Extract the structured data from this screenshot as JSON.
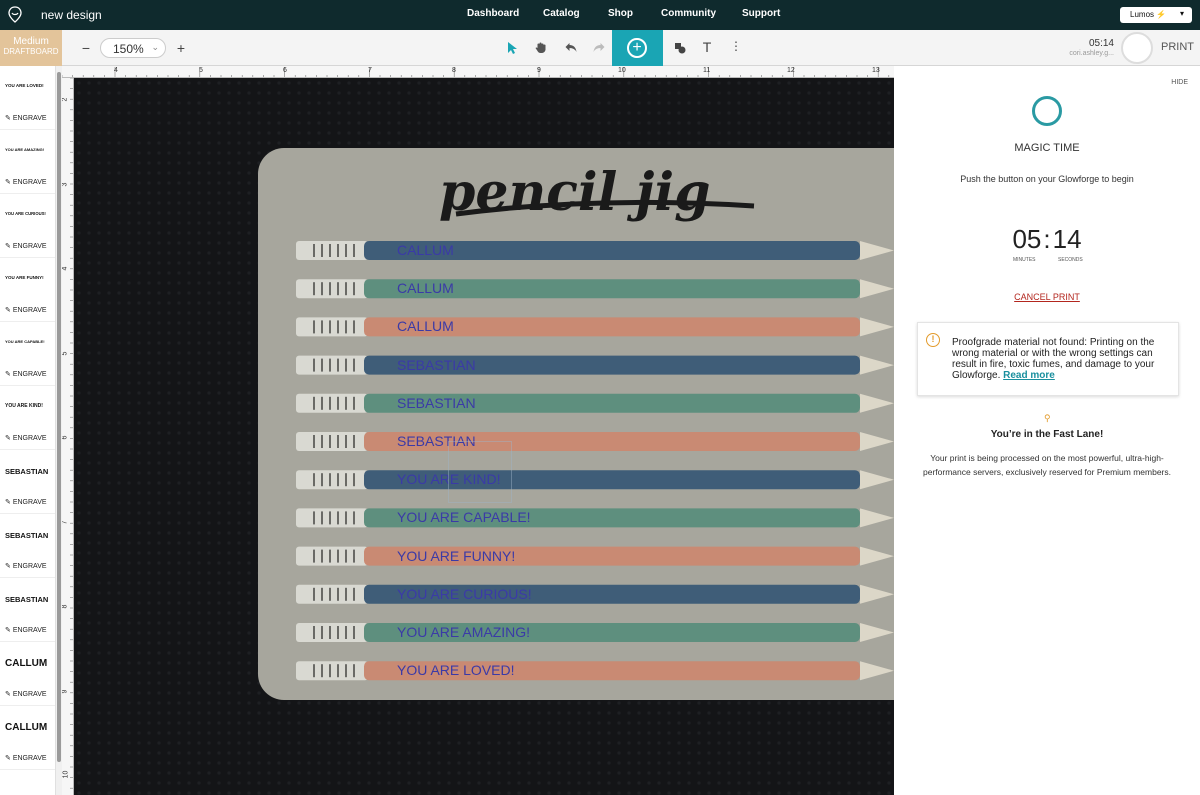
{
  "app": {
    "design_title": "new design",
    "nav": [
      "Dashboard",
      "Catalog",
      "Shop",
      "Community",
      "Support"
    ],
    "machine_name": "Lumos",
    "machine_icon": "lightning-icon"
  },
  "toolbar": {
    "material_name": "Medium",
    "material_type": "DRAFTBOARD",
    "zoom": "150%",
    "timer": "05:14",
    "user_email": "cori.ashley.g...",
    "print_label": "PRINT",
    "icons": [
      "zoom-out-icon",
      "zoom-in-icon",
      "select-arrow-icon",
      "pan-hand-icon",
      "undo-icon",
      "redo-icon",
      "add-icon",
      "shapes-icon",
      "text-icon",
      "more-icon"
    ]
  },
  "thumbnails": [
    {
      "text": "YOU ARE LOVED!",
      "action": "ENGRAVE"
    },
    {
      "text": "YOU ARE AMAZING!",
      "action": "ENGRAVE"
    },
    {
      "text": "YOU ARE CURIOUS!",
      "action": "ENGRAVE"
    },
    {
      "text": "YOU ARE FUNNY!",
      "action": "ENGRAVE"
    },
    {
      "text": "YOU ARE CAPABLE!",
      "action": "ENGRAVE"
    },
    {
      "text": "YOU ARE KIND!",
      "action": "ENGRAVE"
    },
    {
      "text": "SEBASTIAN",
      "action": "ENGRAVE"
    },
    {
      "text": "SEBASTIAN",
      "action": "ENGRAVE"
    },
    {
      "text": "SEBASTIAN",
      "action": "ENGRAVE"
    },
    {
      "text": "CALLUM",
      "action": "ENGRAVE"
    },
    {
      "text": "CALLUM",
      "action": "ENGRAVE"
    }
  ],
  "rulers": {
    "top": [
      "4",
      "5",
      "6",
      "7",
      "8",
      "9",
      "10",
      "11",
      "12",
      "13"
    ],
    "left": [
      "2",
      "3",
      "4",
      "5",
      "6",
      "7",
      "8",
      "9",
      "10"
    ]
  },
  "canvas": {
    "jig_logo": "pencil jig",
    "design_texts": [
      "CALLUM",
      "CALLUM",
      "CALLUM",
      "SEBASTIAN",
      "SEBASTIAN",
      "SEBASTIAN",
      "YOU ARE KIND!",
      "YOU ARE CAPABLE!",
      "YOU ARE FUNNY!",
      "YOU ARE CURIOUS!",
      "YOU ARE AMAZING!",
      "YOU ARE LOVED!"
    ],
    "pencil_colors": [
      "#3f5d78",
      "#5e8f7e",
      "#c98a73"
    ],
    "text_color": "#3b3aa7"
  },
  "panel": {
    "hide": "HIDE",
    "title": "MAGIC TIME",
    "instruction": "Push the button on your Glowforge to begin",
    "minutes": "05",
    "seconds": "14",
    "minutes_label": "MINUTES",
    "seconds_label": "SECONDS",
    "cancel": "CANCEL PRINT",
    "warning_text": "Proofgrade material not found: Printing on the wrong material or with the wrong settings can result in fire, toxic fumes, and damage to your Glowforge.",
    "warning_link": "Read more",
    "fast_title": "You’re in the Fast Lane!",
    "fast_body": "Your print is being processed on the most powerful, ultra-high-performance servers, exclusively reserved for Premium members.",
    "accent_color": "#1aa5b4",
    "warning_color": "#e39b2b"
  }
}
